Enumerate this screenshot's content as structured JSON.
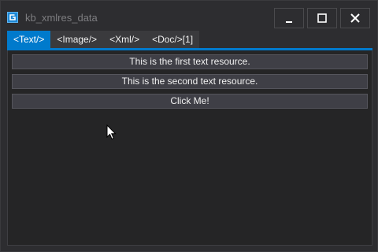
{
  "window": {
    "title": "kb_xmlres_data",
    "app_icon": "app-icon",
    "controls": {
      "minimize_icon": "minimize-icon",
      "maximize_icon": "maximize-icon",
      "close_icon": "close-icon"
    }
  },
  "tabs": [
    {
      "label": "<Text/>",
      "active": true
    },
    {
      "label": "<Image/>",
      "active": false
    },
    {
      "label": "<Xml/>",
      "active": false
    },
    {
      "label": "<Doc/>[1]",
      "active": false
    }
  ],
  "content": {
    "buttons": [
      {
        "label": "This is the first text resource."
      },
      {
        "label": "This is the second text resource."
      },
      {
        "label": "Click Me!"
      }
    ]
  },
  "colors": {
    "accent": "#007acc",
    "background": "#2d2d30",
    "panel": "#252526",
    "button": "#3f3f46",
    "text": "#f1f1f1"
  }
}
